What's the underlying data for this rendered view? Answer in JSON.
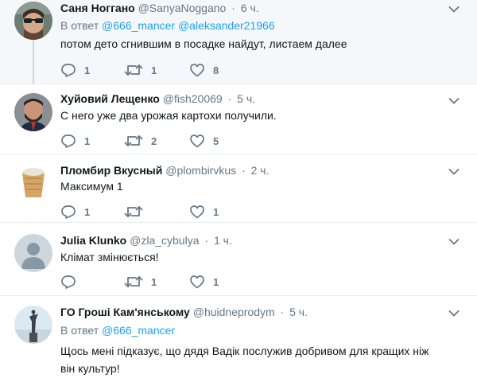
{
  "tweets": [
    {
      "name": "Саня Ногганo",
      "handle": "@SanyaNoggano",
      "time": "6 ч.",
      "reply_prefix": "В ответ",
      "reply_to": [
        "@666_mancer",
        "@aleksander21966"
      ],
      "text": "потом дето сгнившим в посадке найдут, листаем далее",
      "replies": "1",
      "retweets": "1",
      "likes": "8",
      "avatar": "man-with-sunglasses-avatar"
    },
    {
      "name": "Хуйовий Лещенко",
      "handle": "@fish20069",
      "time": "5 ч.",
      "text": "С него уже два урожая картохи получили.",
      "replies": "1",
      "retweets": "2",
      "likes": "5",
      "avatar": "bearded-man-avatar"
    },
    {
      "name": "Пломбир Вкусный",
      "handle": "@plombirvkus",
      "time": "2 ч.",
      "text": "Максимум 1",
      "replies": "1",
      "retweets": "",
      "likes": "1",
      "avatar": "ice-cream-avatar"
    },
    {
      "name": "Julia Klunko",
      "handle": "@zla_cybulya",
      "time": "1 ч.",
      "text": "Клімат змінюється!",
      "replies": "",
      "retweets": "1",
      "likes": "1",
      "avatar": "default-user-avatar"
    },
    {
      "name": "ГО Гроші Кам'янському",
      "handle": "@huidneprodym",
      "time": "5 ч.",
      "reply_prefix": "В ответ",
      "reply_to": [
        "@666_mancer"
      ],
      "text": "Щось мені підказує, що дядя Вадік послужив добривом для кращих ніж він культур!",
      "avatar": "statue-avatar"
    }
  ],
  "colors": {
    "link": "#1da1f2",
    "secondary_text": "#657786",
    "thread_line": "#ccd6dd",
    "divider": "#e6ecf0",
    "highlight_bg": "#f5f8fa"
  },
  "icons": [
    "reply-icon",
    "retweet-icon",
    "like-icon",
    "caret-down-icon"
  ]
}
